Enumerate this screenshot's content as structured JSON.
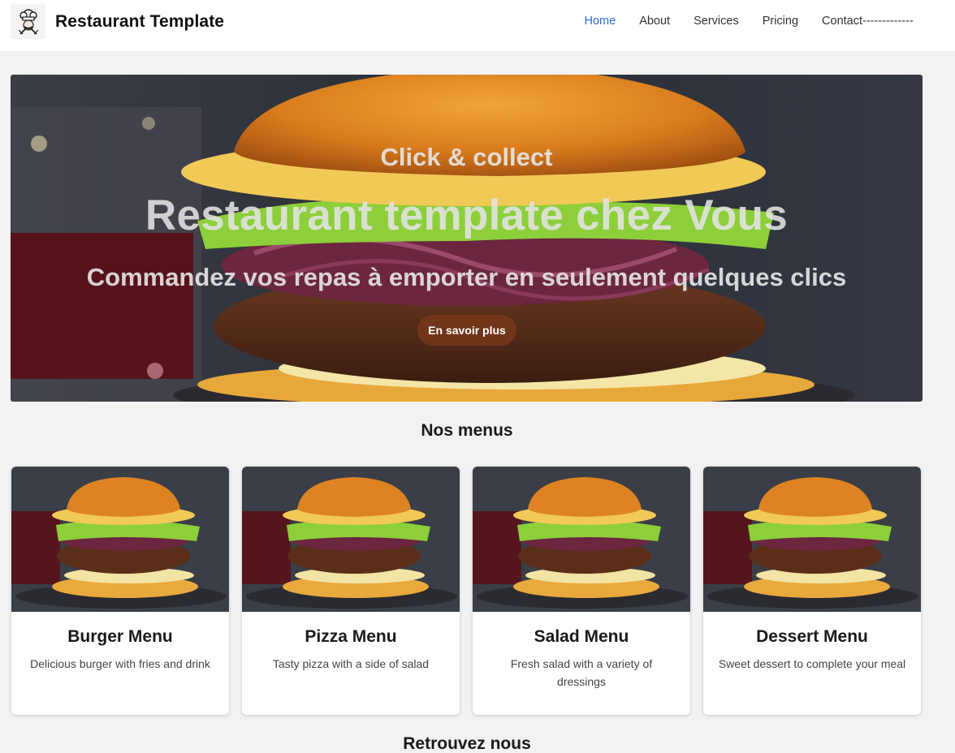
{
  "navbar": {
    "brand": "Restaurant Template",
    "links": [
      {
        "label": "Home",
        "active": true
      },
      {
        "label": "About",
        "active": false
      },
      {
        "label": "Services",
        "active": false
      },
      {
        "label": "Pricing",
        "active": false
      },
      {
        "label": "Contact-------------",
        "active": false
      }
    ],
    "active_color": "#2c6cd1"
  },
  "hero": {
    "kicker": "Click & collect",
    "headline": "Restaurant template chez Vous",
    "tagline": "Commandez vos repas à emporter en seulement quelques clics",
    "cta_label": "En savoir plus"
  },
  "sections": {
    "menus_title": "Nos menus",
    "find_us_title": "Retrouvez nous"
  },
  "menus": [
    {
      "title": "Burger Menu",
      "description": "Delicious burger with fries and drink"
    },
    {
      "title": "Pizza Menu",
      "description": "Tasty pizza with a side of salad"
    },
    {
      "title": "Salad Menu",
      "description": "Fresh salad with a variety of dressings"
    },
    {
      "title": "Dessert Menu",
      "description": "Sweet dessert to complete your meal"
    }
  ],
  "icons": {
    "logo": "chef-logo-icon",
    "hero_image": "burger-photo",
    "card_image": "burger-photo"
  }
}
